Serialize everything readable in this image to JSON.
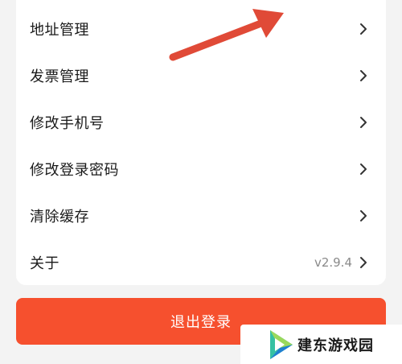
{
  "settings": {
    "items": [
      {
        "label": "地址管理"
      },
      {
        "label": "发票管理"
      },
      {
        "label": "修改手机号"
      },
      {
        "label": "修改登录密码"
      },
      {
        "label": "清除缓存"
      },
      {
        "label": "关于",
        "value": "v2.9.4"
      }
    ],
    "icons": {
      "row_action": "chevron-right-icon"
    }
  },
  "logout": {
    "label": "退出登录"
  },
  "watermark": {
    "text": "建东游戏园"
  },
  "colors": {
    "background": "#f3f3f3",
    "card": "#ffffff",
    "logout_button": "#f6502e",
    "annotation_arrow": "#e04a37"
  }
}
